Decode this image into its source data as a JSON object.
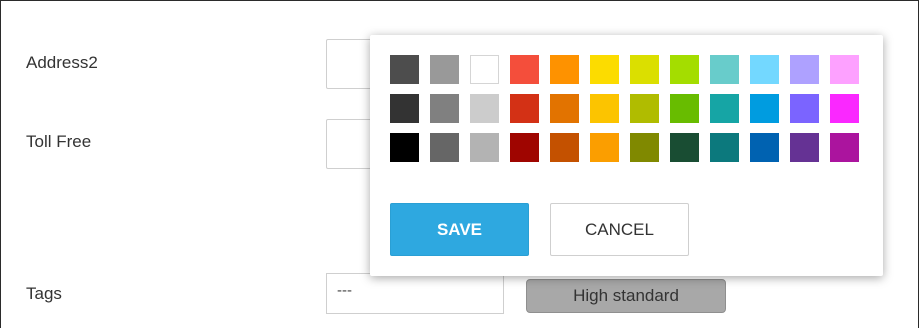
{
  "form": {
    "fields": [
      {
        "label": "Address2",
        "value": ""
      },
      {
        "label": "Toll Free",
        "value": ""
      },
      {
        "label": "Tags",
        "value": "---"
      }
    ],
    "tag_badge": "High standard"
  },
  "color_picker": {
    "selected_color": "#bdbdbd",
    "swatches": [
      [
        "#4d4d4d",
        "#999999",
        "#ffffff",
        "#f44e3b",
        "#fe9200",
        "#fcdc00",
        "#dbdf00",
        "#a4dd00",
        "#68cccb",
        "#73d8ff",
        "#aea1ff",
        "#fda1ff"
      ],
      [
        "#333333",
        "#808080",
        "#cccccc",
        "#d33115",
        "#e27300",
        "#fcc400",
        "#b0bc00",
        "#68bc00",
        "#16a5a5",
        "#009ce0",
        "#7b64ff",
        "#fa28ff"
      ],
      [
        "#000000",
        "#666666",
        "#b3b3b3",
        "#9f0500",
        "#c45100",
        "#fb9e00",
        "#808900",
        "#194d33",
        "#0c797d",
        "#0062b1",
        "#653294",
        "#ab149e"
      ]
    ],
    "save_label": "SAVE",
    "cancel_label": "CANCEL"
  }
}
